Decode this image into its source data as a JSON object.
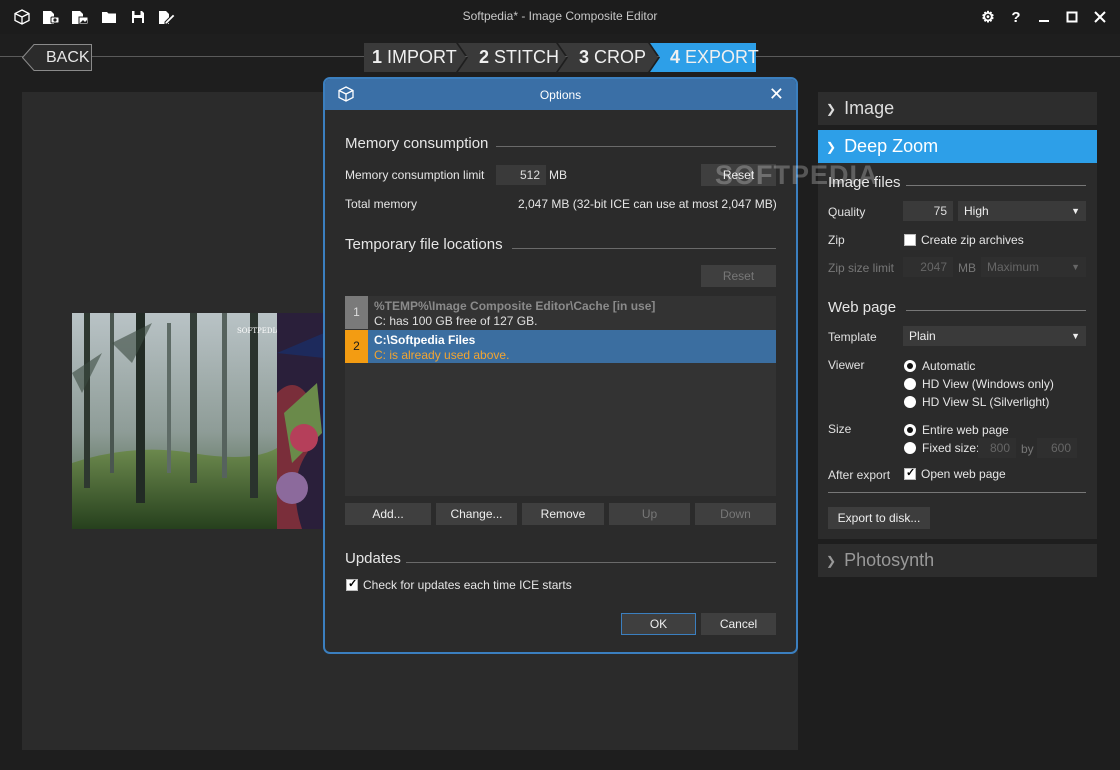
{
  "window": {
    "title": "Softpedia* - Image Composite Editor",
    "toolbar_icons": [
      "new-panorama-icon",
      "new-from-video-icon",
      "new-from-images-icon",
      "open-icon",
      "save-icon",
      "export-project-icon"
    ],
    "controls": [
      "settings-icon",
      "help-icon",
      "minimize-icon",
      "maximize-icon",
      "close-icon"
    ]
  },
  "nav": {
    "back_label": "BACK",
    "steps": [
      {
        "num": "1",
        "label": "IMPORT"
      },
      {
        "num": "2",
        "label": "STITCH"
      },
      {
        "num": "3",
        "label": "CROP"
      },
      {
        "num": "4",
        "label": "EXPORT"
      }
    ],
    "active_step": 4
  },
  "preview": {
    "watermark": "SOFTPEDIA"
  },
  "right_panel": {
    "image_header": "Image",
    "deepzoom_header": "Deep Zoom",
    "photosynth_header": "Photosynth",
    "image_files": {
      "title": "Image files",
      "quality_label": "Quality",
      "quality_value": "75",
      "quality_preset": "High",
      "zip_label": "Zip",
      "zip_checkbox_label": "Create zip archives",
      "zip_checked": false,
      "zip_size_label": "Zip size limit",
      "zip_size_value": "2047",
      "zip_size_unit": "MB",
      "zip_size_preset": "Maximum"
    },
    "web_page": {
      "title": "Web page",
      "template_label": "Template",
      "template_value": "Plain",
      "viewer_label": "Viewer",
      "viewer_options": [
        "Automatic",
        "HD View (Windows only)",
        "HD View SL (Silverlight)"
      ],
      "viewer_selected": 0,
      "size_label": "Size",
      "size_options": [
        "Entire web page",
        "Fixed size:"
      ],
      "size_selected": 0,
      "fixed_w": "800",
      "fixed_by": "by",
      "fixed_h": "600",
      "after_export_label": "After export",
      "open_web_page_label": "Open web page",
      "open_web_page_checked": true
    },
    "export_button": "Export to disk..."
  },
  "dialog": {
    "title": "Options",
    "memory": {
      "title": "Memory consumption",
      "limit_label": "Memory consumption limit",
      "limit_value": "512",
      "limit_unit": "MB",
      "reset_label": "Reset",
      "total_label": "Total memory",
      "total_value": "2,047 MB (32-bit ICE can use at most 2,047 MB)"
    },
    "temp": {
      "title": "Temporary file locations",
      "reset_label": "Reset",
      "locations": [
        {
          "num": "1",
          "path": "%TEMP%\\Image Composite Editor\\Cache   [in use]",
          "info": "C: has 100 GB free of 127 GB."
        },
        {
          "num": "2",
          "path": "C:\\Softpedia Files",
          "info": "C: is already used above."
        }
      ],
      "selected_index": 1,
      "buttons": [
        "Add...",
        "Change...",
        "Remove",
        "Up",
        "Down"
      ]
    },
    "updates": {
      "title": "Updates",
      "check_label": "Check for updates each time ICE starts",
      "checked": true
    },
    "ok_label": "OK",
    "cancel_label": "Cancel"
  },
  "colors": {
    "accent_blue": "#2d9fe8",
    "dialog_title": "#3a6fa6",
    "selected_row": "#3b6ea0",
    "orange_badge": "#f39c12"
  }
}
